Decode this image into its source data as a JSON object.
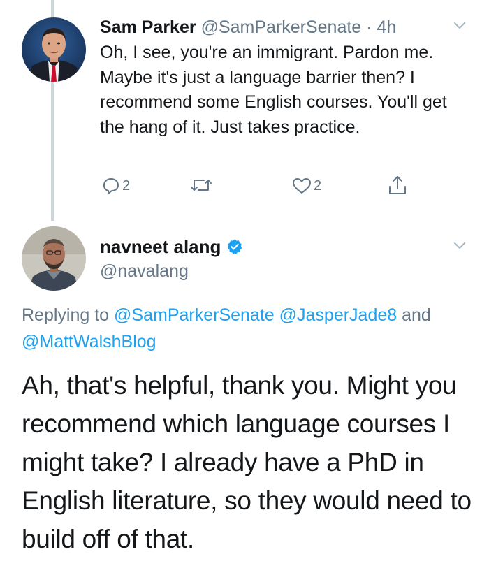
{
  "tweet1": {
    "name": "Sam Parker",
    "handle": "@SamParkerSenate",
    "separator": "·",
    "time": "4h",
    "text": "Oh, I see, you're an immigrant. Pardon me. Maybe it's just a language barrier then? I recommend some English courses. You'll get the hang of it. Just takes practice.",
    "reply_count": "2",
    "like_count": "2"
  },
  "tweet2": {
    "name": "navneet alang",
    "handle": "@navalang",
    "verified": true,
    "replying_prefix": "Replying to",
    "mention1": "@SamParkerSenate",
    "mention2": "@JasperJade8",
    "replying_and": "and",
    "mention3": "@MattWalshBlog",
    "text": "Ah, that's helpful, thank you. Might you recommend which language courses I might take? I already have a PhD in English literature, so they would need to build off of that."
  },
  "colors": {
    "text": "#14171a",
    "secondary": "#657786",
    "link": "#1da1f2",
    "thread_line": "#ccd6dd"
  },
  "icons": [
    "reply-icon",
    "retweet-icon",
    "like-icon",
    "share-icon",
    "chevron-down-icon",
    "verified-badge-icon"
  ]
}
